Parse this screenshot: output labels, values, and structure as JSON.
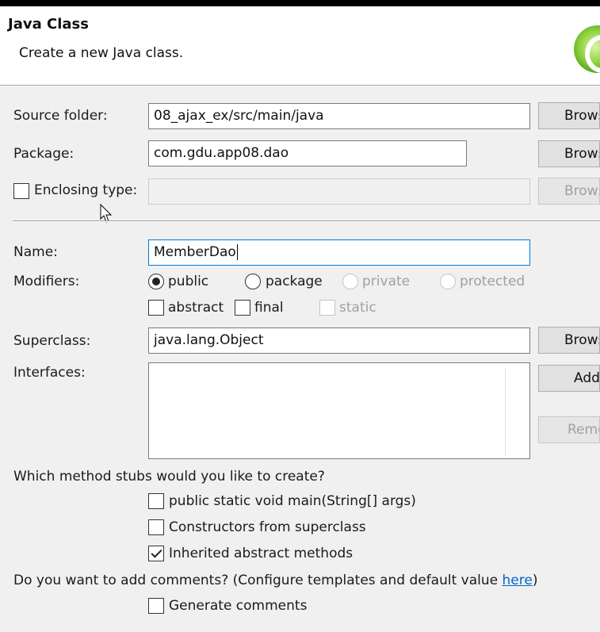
{
  "header": {
    "title": "Java Class",
    "subtitle": "Create a new Java class."
  },
  "source_folder": {
    "label": "Source folder:",
    "value": "08_ajax_ex/src/main/java",
    "button": "Browse..."
  },
  "package": {
    "label": "Package:",
    "value": "com.gdu.app08.dao",
    "button": "Browse..."
  },
  "enclosing_type": {
    "label": "Enclosing type:",
    "checked": false,
    "value": "",
    "button": "Browse..."
  },
  "name": {
    "label": "Name:",
    "value": "MemberDao"
  },
  "modifiers": {
    "label": "Modifiers:",
    "radios": [
      {
        "label": "public",
        "checked": true,
        "enabled": true
      },
      {
        "label": "package",
        "checked": false,
        "enabled": true
      },
      {
        "label": "private",
        "checked": false,
        "enabled": false
      },
      {
        "label": "protected",
        "checked": false,
        "enabled": false
      }
    ],
    "checkboxes": [
      {
        "label": "abstract",
        "checked": false,
        "enabled": true
      },
      {
        "label": "final",
        "checked": false,
        "enabled": true
      },
      {
        "label": "static",
        "checked": false,
        "enabled": false
      }
    ]
  },
  "superclass": {
    "label": "Superclass:",
    "value": "java.lang.Object",
    "button": "Browse..."
  },
  "interfaces": {
    "label": "Interfaces:",
    "add_button": "Add...",
    "remove_button": "Remove"
  },
  "stubs": {
    "question": "Which method stubs would you like to create?",
    "options": [
      {
        "label": "public static void main(String[] args)",
        "checked": false
      },
      {
        "label": "Constructors from superclass",
        "checked": false
      },
      {
        "label": "Inherited abstract methods",
        "checked": true
      }
    ]
  },
  "comments": {
    "question_prefix": "Do you want to add comments? (Configure templates and default value ",
    "link": "here",
    "question_suffix": ")",
    "option": {
      "label": "Generate comments",
      "checked": false
    }
  }
}
